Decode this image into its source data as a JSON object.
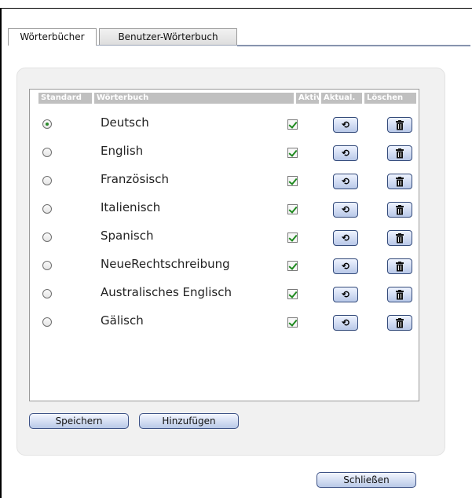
{
  "tabs": [
    {
      "label": "Wörterbücher",
      "active": true
    },
    {
      "label": "Benutzer-Wörterbuch",
      "active": false
    }
  ],
  "table": {
    "headers": {
      "standard": "Standard",
      "dictionary": "Wörterbuch",
      "active": "Aktiv",
      "update": "Aktual.",
      "delete": "Löschen"
    },
    "rows": [
      {
        "name": "Deutsch",
        "default": true,
        "active": true
      },
      {
        "name": "English",
        "default": false,
        "active": true
      },
      {
        "name": "Französisch",
        "default": false,
        "active": true
      },
      {
        "name": "Italienisch",
        "default": false,
        "active": true
      },
      {
        "name": "Spanisch",
        "default": false,
        "active": true
      },
      {
        "name": "NeueRechtschreibung",
        "default": false,
        "active": true
      },
      {
        "name": "Australisches Englisch",
        "default": false,
        "active": true
      },
      {
        "name": "Gälisch",
        "default": false,
        "active": true
      }
    ]
  },
  "icons": {
    "update": "refresh-icon",
    "delete": "trash-icon"
  },
  "buttons": {
    "save": "Speichern",
    "add": "Hinzufügen",
    "close": "Schließen"
  },
  "colors": {
    "button_border": "#3d5286",
    "check_green": "#1f8a1f",
    "header_gray": "#c0c0c0"
  }
}
